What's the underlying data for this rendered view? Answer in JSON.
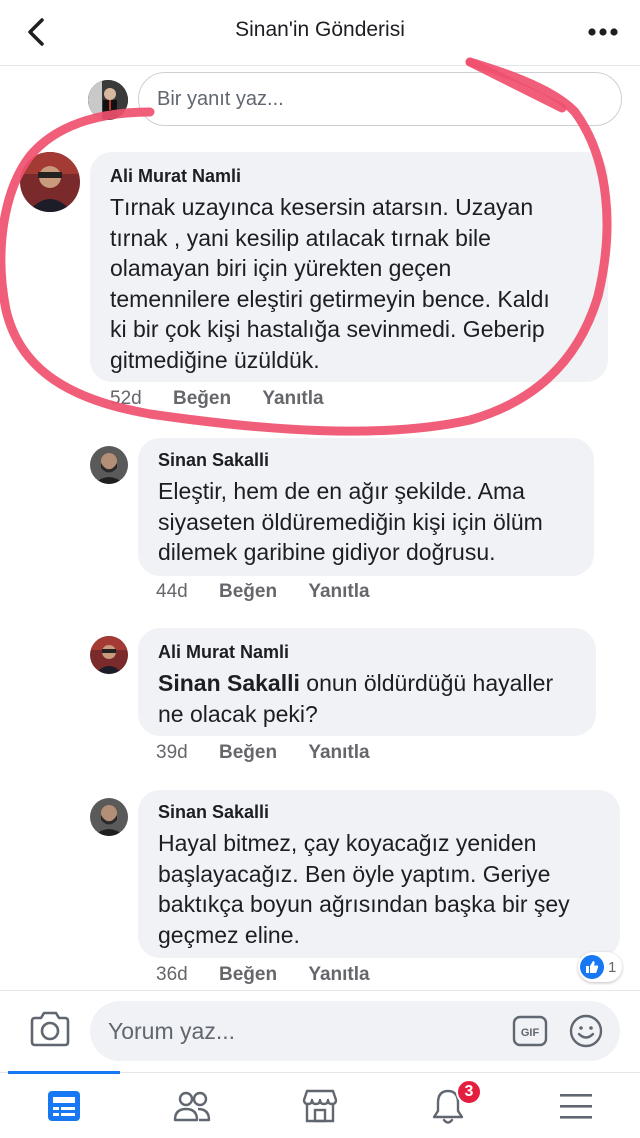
{
  "header": {
    "title": "Sinan'in Gönderisi"
  },
  "reply_box": {
    "placeholder": "Bir yanıt yaz..."
  },
  "comments": [
    {
      "author": "Ali Murat Namli",
      "text": "Tırnak uzayınca kesersin atarsın. Uzayan tırnak , yani kesilip atılacak tırnak bile olamayan biri için yürekten geçen temennilere eleştiri getirmeyin bence. Kaldı ki bir çok kişi hastalığa sevinmedi. Geberip gitmediğine üzüldük.",
      "lines": [
        "Tırnak uzayınca kesersin atarsın. Uzayan",
        "tırnak , yani kesilip atılacak tırnak bile",
        "olamayan biri için yürekten geçen",
        "temennilere eleştiri getirmeyin bence. Kaldı",
        "ki bir çok kişi hastalığa sevinmedi. Geberip",
        "gitmediğine üzüldük."
      ],
      "time": "52d",
      "like": "Beğen",
      "reply": "Yanıtla"
    },
    {
      "author": "Sinan Sakalli",
      "lines": [
        "Eleştir, hem de en ağır şekilde.  Ama",
        "siyaseten öldüremediğin kişi için ölüm",
        "dilemek garibine gidiyor doğrusu."
      ],
      "time": "44d",
      "like": "Beğen",
      "reply": "Yanıtla"
    },
    {
      "author": "Ali Murat Namli",
      "mention": "Sinan Sakalli",
      "line1_rest": " onun öldürdüğü hayaller",
      "line2": "ne olacak peki?",
      "time": "39d",
      "like": "Beğen",
      "reply": "Yanıtla"
    },
    {
      "author": "Sinan Sakalli",
      "lines": [
        "Hayal bitmez, çay koyacağız yeniden",
        "başlayacağız. Ben öyle yaptım. Geriye",
        "baktıkça boyun ağrısından başka bir şey",
        "geçmez eline."
      ],
      "time": "36d",
      "like": "Beğen",
      "reply": "Yanıtla",
      "reaction_count": "1"
    }
  ],
  "composer": {
    "placeholder": "Yorum yaz...",
    "gif_label": "GIF"
  },
  "tabbar": {
    "notification_badge": "3"
  },
  "colors": {
    "accent": "#1877f2",
    "badge": "#e41e3f",
    "annotation": "#f0506e"
  }
}
